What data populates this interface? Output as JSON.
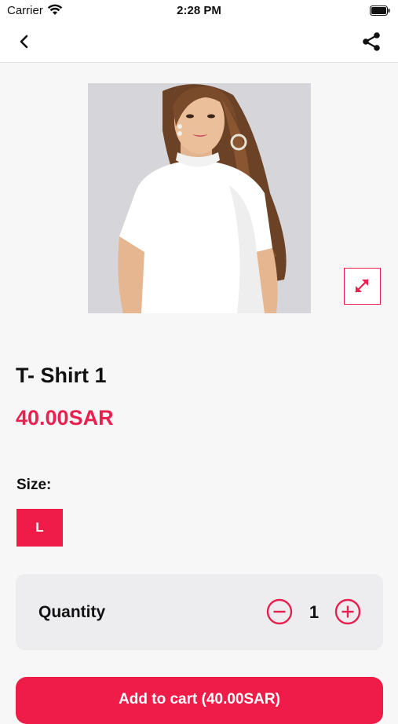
{
  "status_bar": {
    "carrier": "Carrier",
    "time": "2:28 PM"
  },
  "nav": {
    "back_icon": "chevron-left-icon",
    "share_icon": "share-icon"
  },
  "product": {
    "image": "model-white-tshirt-photo",
    "expand_icon": "expand-arrows-icon",
    "title": "T- Shirt 1",
    "price": "40.00SAR",
    "size_label": "Size:",
    "sizes": [
      "L"
    ],
    "selected_size": "L"
  },
  "quantity": {
    "label": "Quantity",
    "value": "1"
  },
  "cart": {
    "button_label": "Add to cart (40.00SAR)"
  },
  "colors": {
    "accent": "#f01c48",
    "card_bg": "#ededf0",
    "page_bg": "#f7f7f8"
  }
}
